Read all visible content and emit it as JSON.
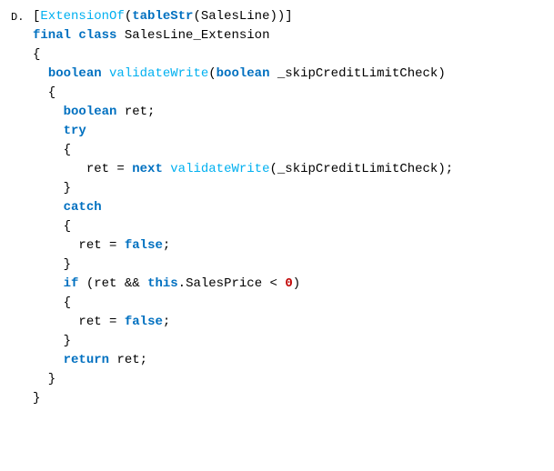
{
  "label": "D.",
  "tokens": {
    "l1_extensionof": "ExtensionOf",
    "l1_tablestr": "tableStr",
    "l1_salesline": "SalesLine",
    "l2_final": "final",
    "l2_class": "class",
    "l2_classname": "SalesLine_Extension",
    "l4_boolean": "boolean",
    "l4_method": "validateWrite",
    "l4_param_boolean": "boolean",
    "l4_param_name": "_skipCreditLimitCheck",
    "l6_boolean": "boolean",
    "l6_ret": "ret",
    "l7_try": "try",
    "l9_ret": "ret",
    "l9_next": "next",
    "l9_method": "validateWrite",
    "l9_param": "_skipCreditLimitCheck",
    "l11_catch": "catch",
    "l13_ret": "ret",
    "l13_false": "false",
    "l15_if": "if",
    "l15_ret": "ret",
    "l15_this": "this",
    "l15_salesprice": "SalesPrice",
    "l15_zero": "0",
    "l17_ret": "ret",
    "l17_false": "false",
    "l19_return": "return",
    "l19_ret": "ret"
  }
}
